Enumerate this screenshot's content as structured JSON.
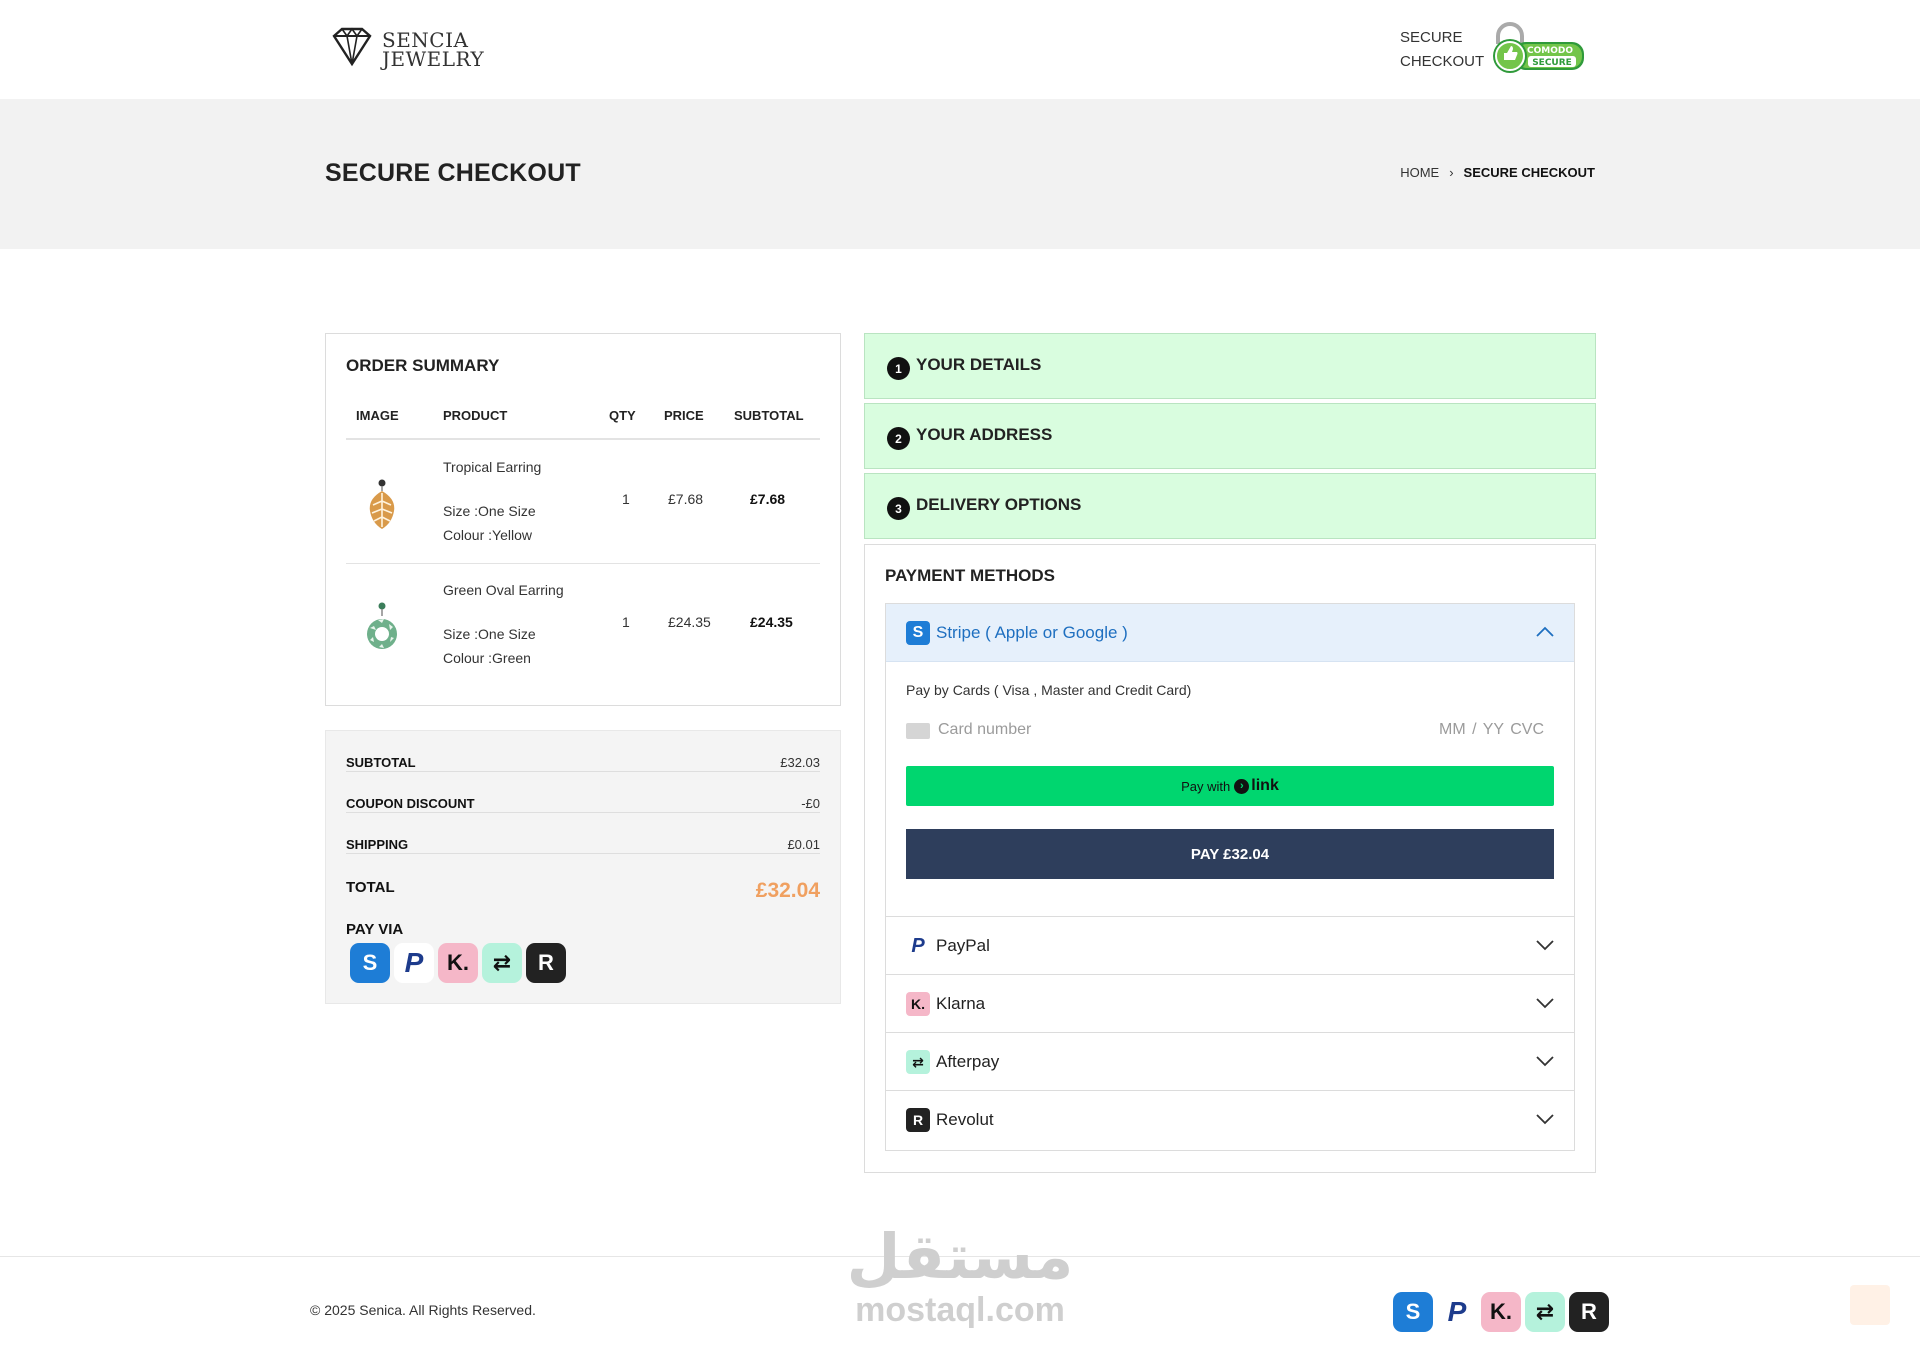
{
  "header": {
    "logo_line1": "SENCIA",
    "logo_line2": "JEWELRY",
    "secure_line1": "SECURE",
    "secure_line2": "CHECKOUT",
    "comodo_line1": "COMODO",
    "comodo_line2": "SECURE"
  },
  "banner": {
    "title": "SECURE CHECKOUT",
    "breadcrumb_home": "HOME",
    "breadcrumb_sep": "›",
    "breadcrumb_current": "SECURE CHECKOUT"
  },
  "order": {
    "title": "ORDER SUMMARY",
    "columns": [
      "IMAGE",
      "PRODUCT",
      "QTY",
      "PRICE",
      "SUBTOTAL"
    ],
    "items": [
      {
        "name": "Tropical Earring",
        "size": "Size :One Size",
        "colour": "Colour :Yellow",
        "qty": "1",
        "price": "£7.68",
        "subtotal": "£7.68"
      },
      {
        "name": "Green Oval Earring",
        "size": "Size :One Size",
        "colour": "Colour :Green",
        "qty": "1",
        "price": "£24.35",
        "subtotal": "£24.35"
      }
    ]
  },
  "totals": {
    "subtotal_label": "SUBTOTAL",
    "subtotal_value": "£32.03",
    "coupon_label": "COUPON DISCOUNT",
    "coupon_value": "-£0",
    "shipping_label": "SHIPPING",
    "shipping_value": "£0.01",
    "total_label": "TOTAL",
    "total_value": "£32.04",
    "payvia_label": "PAY VIA"
  },
  "icons": {
    "stripe": "S",
    "paypal": "P",
    "klarna": "K.",
    "afterpay": "⇄",
    "revolut": "R"
  },
  "steps": [
    {
      "num": "1",
      "title": "YOUR DETAILS"
    },
    {
      "num": "2",
      "title": "YOUR ADDRESS"
    },
    {
      "num": "3",
      "title": "DELIVERY OPTIONS"
    }
  ],
  "payment": {
    "title": "PAYMENT METHODS",
    "open_method": "Stripe ( Apple or Google )",
    "description": "Pay by Cards ( Visa , Master and Credit Card)",
    "card_placeholder": "Card number",
    "exp_cvc_placeholder": "MM / YY  CVC",
    "link_prefix": "Pay with",
    "link_word": "link",
    "pay_button": "PAY £32.04",
    "methods": [
      "PayPal",
      "Klarna",
      "Afterpay",
      "Revolut"
    ]
  },
  "footer": {
    "copyright": "© 2025 Senica. All Rights Reserved.",
    "watermark_ar": "مستقل",
    "watermark_en": "mostaql.com"
  },
  "colors": {
    "step_bg": "#d9fddf",
    "accent_total": "#f0a060",
    "pay_button": "#2e3e5c",
    "link_button": "#00d66f",
    "stripe_blue": "#1e7dd6"
  }
}
